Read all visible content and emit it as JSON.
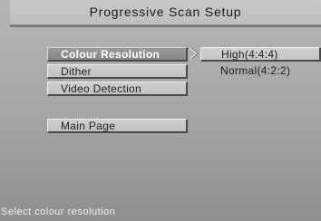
{
  "screen": {
    "title": "Progressive Scan Setup"
  },
  "menu": {
    "items": [
      {
        "label": "Colour Resolution",
        "selected": true
      },
      {
        "label": "Dither",
        "selected": false
      },
      {
        "label": "Video Detection",
        "selected": false
      },
      {
        "label": "Main Page",
        "selected": false
      }
    ]
  },
  "submenu": {
    "indicator_icon": "chevron-right-icon",
    "options": [
      {
        "label": "High(4:4:4)",
        "highlighted": true
      },
      {
        "label": "Normal(4:2:2)",
        "highlighted": false
      }
    ]
  },
  "status": {
    "text": "Select colour resolution"
  }
}
